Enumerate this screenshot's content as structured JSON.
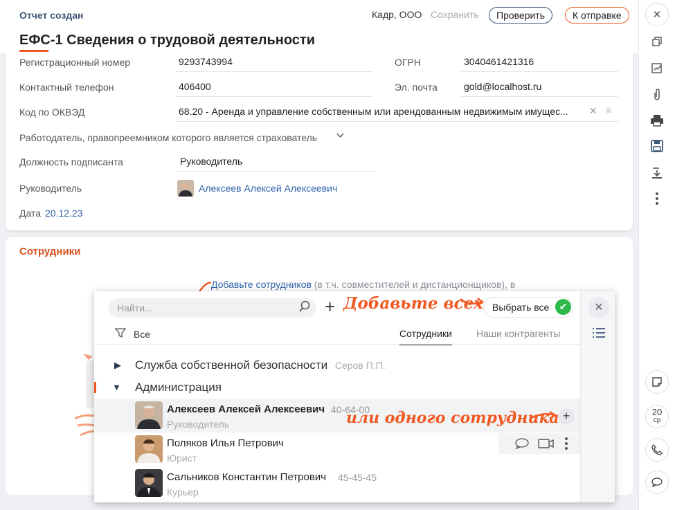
{
  "header": {
    "status": "Отчет создан",
    "title": "ЕФС-1 Сведения о трудовой деятельности",
    "org": "Кадр, ООО",
    "save": "Сохранить",
    "check": "Проверить",
    "send": "К отправке"
  },
  "form": {
    "reg_label": "Регистрационный номер",
    "reg_value": "9293743994",
    "ogrn_label": "ОГРН",
    "ogrn_value": "3040461421316",
    "phone_label": "Контактный телефон",
    "phone_value": "406400",
    "email_label": "Эл. почта",
    "email_value": "gold@localhost.ru",
    "okved_label": "Код по ОКВЭД",
    "okved_value": "68.20 - Аренда и управление собственным или арендованным недвижимым имущес...",
    "successor_label": "Работодатель, правопреемником которого является страхователь",
    "position_label": "Должность подписанта",
    "position_value": "Руководитель",
    "head_label": "Руководитель",
    "head_value": "Алексеев Алексей Алексеевич",
    "date_label": "Дата",
    "date_value": "20.12.23"
  },
  "employees": {
    "title": "Сотрудники",
    "hint_link": "Добавьте сотрудников",
    "hint_rest": " (в т.ч. совместителей и дистанционщиков), в"
  },
  "popup": {
    "search_placeholder": "Найти...",
    "select_all": "Выбрать все",
    "filter": "Все",
    "tab_employees": "Сотрудники",
    "tab_contractors": "Наши контрагенты",
    "note_add_all": "Добавьте всех",
    "note_add_one": "или одного сотрудника",
    "groups": [
      {
        "name": "Служба собственной безопасности",
        "head": "Серов П.П."
      },
      {
        "name": "Администрация"
      }
    ],
    "people": [
      {
        "name": "Алексеев Алексей Алексеевич",
        "phone": "40-64-00",
        "role": "Руководитель"
      },
      {
        "name": "Поляков Илья Петрович",
        "phone": "",
        "role": "Юрист"
      },
      {
        "name": "Сальников Константин Петрович",
        "phone": "45-45-45",
        "role": "Курьер"
      }
    ]
  },
  "rail": {
    "date_day": "20",
    "date_wd": "ср"
  },
  "colors": {
    "accent": "#f05a22",
    "link": "#2f63a8",
    "navy": "#3b5575",
    "success": "#2db84a"
  }
}
